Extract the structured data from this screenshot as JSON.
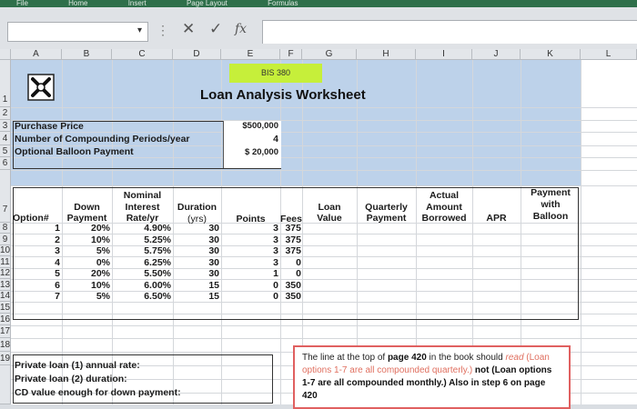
{
  "ribbon": {
    "tabs": [
      "File",
      "Home",
      "Insert",
      "Page Layout",
      "Formulas"
    ]
  },
  "formula_bar": {
    "cancel": "✕",
    "enter": "✓",
    "fx": "fx"
  },
  "columns": [
    "A",
    "B",
    "C",
    "D",
    "E",
    "F",
    "G",
    "H",
    "I",
    "J",
    "K",
    "L"
  ],
  "rows": [
    "1",
    "2",
    "3",
    "4",
    "5",
    "6",
    "7",
    "8",
    "9",
    "10",
    "11",
    "12",
    "13",
    "14",
    "15",
    "16",
    "17",
    "18",
    "19"
  ],
  "sheet": {
    "bis": "BIS 380",
    "title": "Loan Analysis Worksheet",
    "inputs": [
      {
        "label": "Purchase Price",
        "value": "$500,000"
      },
      {
        "label": "Number of Compounding Periods/year",
        "value": "4"
      },
      {
        "label": "Optional Balloon Payment",
        "value": "$ 20,000"
      }
    ],
    "headers": {
      "option": "Option#",
      "down_1": "Down",
      "down_2": "Payment",
      "int_1": "Nominal",
      "int_2": "Interest",
      "int_3": "Rate/yr",
      "dur_1": "Duration",
      "dur_2": "(yrs)",
      "points": "Points",
      "fees": "Fees",
      "loan_1": "Loan",
      "loan_2": "Value",
      "qp_1": "Quarterly",
      "qp_2": "Payment",
      "ab_1": "Actual",
      "ab_2": "Amount",
      "ab_3": "Borrowed",
      "apr": "APR",
      "pb_1": "Payment",
      "pb_2": "with",
      "pb_3": "Balloon"
    },
    "table": [
      {
        "opt": "1",
        "down": "20%",
        "rate": "4.90%",
        "dur": "30",
        "pts": "3",
        "fees": "375"
      },
      {
        "opt": "2",
        "down": "10%",
        "rate": "5.25%",
        "dur": "30",
        "pts": "3",
        "fees": "375"
      },
      {
        "opt": "3",
        "down": "5%",
        "rate": "5.75%",
        "dur": "30",
        "pts": "3",
        "fees": "375"
      },
      {
        "opt": "4",
        "down": "0%",
        "rate": "6.25%",
        "dur": "30",
        "pts": "3",
        "fees": "0"
      },
      {
        "opt": "5",
        "down": "20%",
        "rate": "5.50%",
        "dur": "30",
        "pts": "1",
        "fees": "0"
      },
      {
        "opt": "6",
        "down": "10%",
        "rate": "6.00%",
        "dur": "15",
        "pts": "0",
        "fees": "350"
      },
      {
        "opt": "7",
        "down": "5%",
        "rate": "6.50%",
        "dur": "15",
        "pts": "0",
        "fees": "350"
      }
    ],
    "bottom_labels": [
      "Private loan (1) annual rate:",
      "Private loan (2) duration:",
      "CD value enough for down payment:"
    ],
    "note": {
      "p1": "The line at the top of ",
      "p2": "page 420",
      "p3": " in the book should ",
      "p4": "read",
      "p5": " (Loan options 1-7 are all compounded quarterly.) ",
      "p6": "not",
      "p7": " (Loan options 1-7 are all compounded monthly.) Also in step 6 on page 420"
    }
  }
}
